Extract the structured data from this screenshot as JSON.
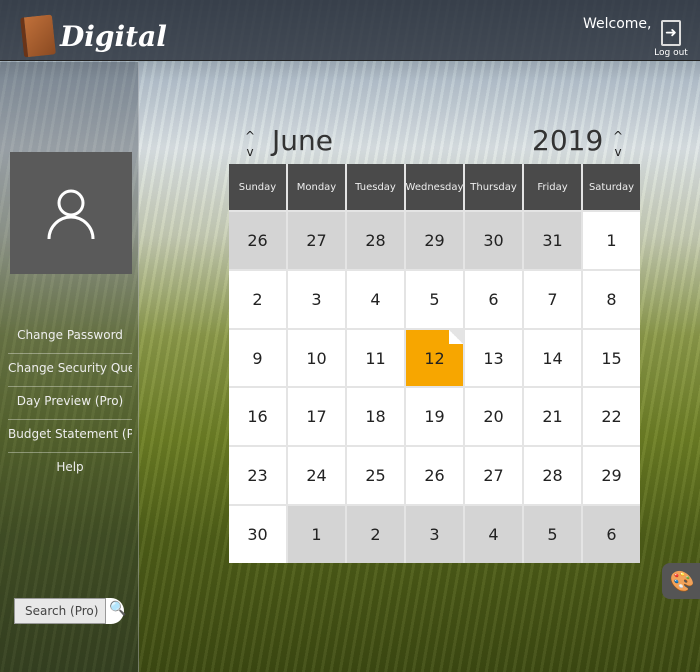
{
  "header": {
    "logo": "Digital",
    "welcome": "Welcome,",
    "logout": "Log out"
  },
  "sidebar": {
    "menu": [
      "Change Password",
      "Change Security Questions",
      "Day Preview (Pro)",
      "Budget Statement (Pro)",
      "Help"
    ],
    "search_placeholder": "Search (Pro)"
  },
  "calendar": {
    "month": "June",
    "year": "2019",
    "weekdays": [
      "Sunday",
      "Monday",
      "Tuesday",
      "Wednesday",
      "Thursday",
      "Friday",
      "Saturday"
    ],
    "days": [
      {
        "d": "26",
        "o": 1
      },
      {
        "d": "27",
        "o": 1
      },
      {
        "d": "28",
        "o": 1
      },
      {
        "d": "29",
        "o": 1
      },
      {
        "d": "30",
        "o": 1
      },
      {
        "d": "31",
        "o": 1
      },
      {
        "d": "1"
      },
      {
        "d": "2"
      },
      {
        "d": "3"
      },
      {
        "d": "4"
      },
      {
        "d": "5"
      },
      {
        "d": "6"
      },
      {
        "d": "7"
      },
      {
        "d": "8"
      },
      {
        "d": "9"
      },
      {
        "d": "10"
      },
      {
        "d": "11"
      },
      {
        "d": "12",
        "t": 1
      },
      {
        "d": "13"
      },
      {
        "d": "14"
      },
      {
        "d": "15"
      },
      {
        "d": "16"
      },
      {
        "d": "17"
      },
      {
        "d": "18"
      },
      {
        "d": "19"
      },
      {
        "d": "20"
      },
      {
        "d": "21"
      },
      {
        "d": "22"
      },
      {
        "d": "23"
      },
      {
        "d": "24"
      },
      {
        "d": "25"
      },
      {
        "d": "26"
      },
      {
        "d": "27"
      },
      {
        "d": "28"
      },
      {
        "d": "29"
      },
      {
        "d": "30"
      },
      {
        "d": "1",
        "o": 1
      },
      {
        "d": "2",
        "o": 1
      },
      {
        "d": "3",
        "o": 1
      },
      {
        "d": "4",
        "o": 1
      },
      {
        "d": "5",
        "o": 1
      },
      {
        "d": "6",
        "o": 1
      }
    ],
    "today_color": "#f7a600"
  }
}
